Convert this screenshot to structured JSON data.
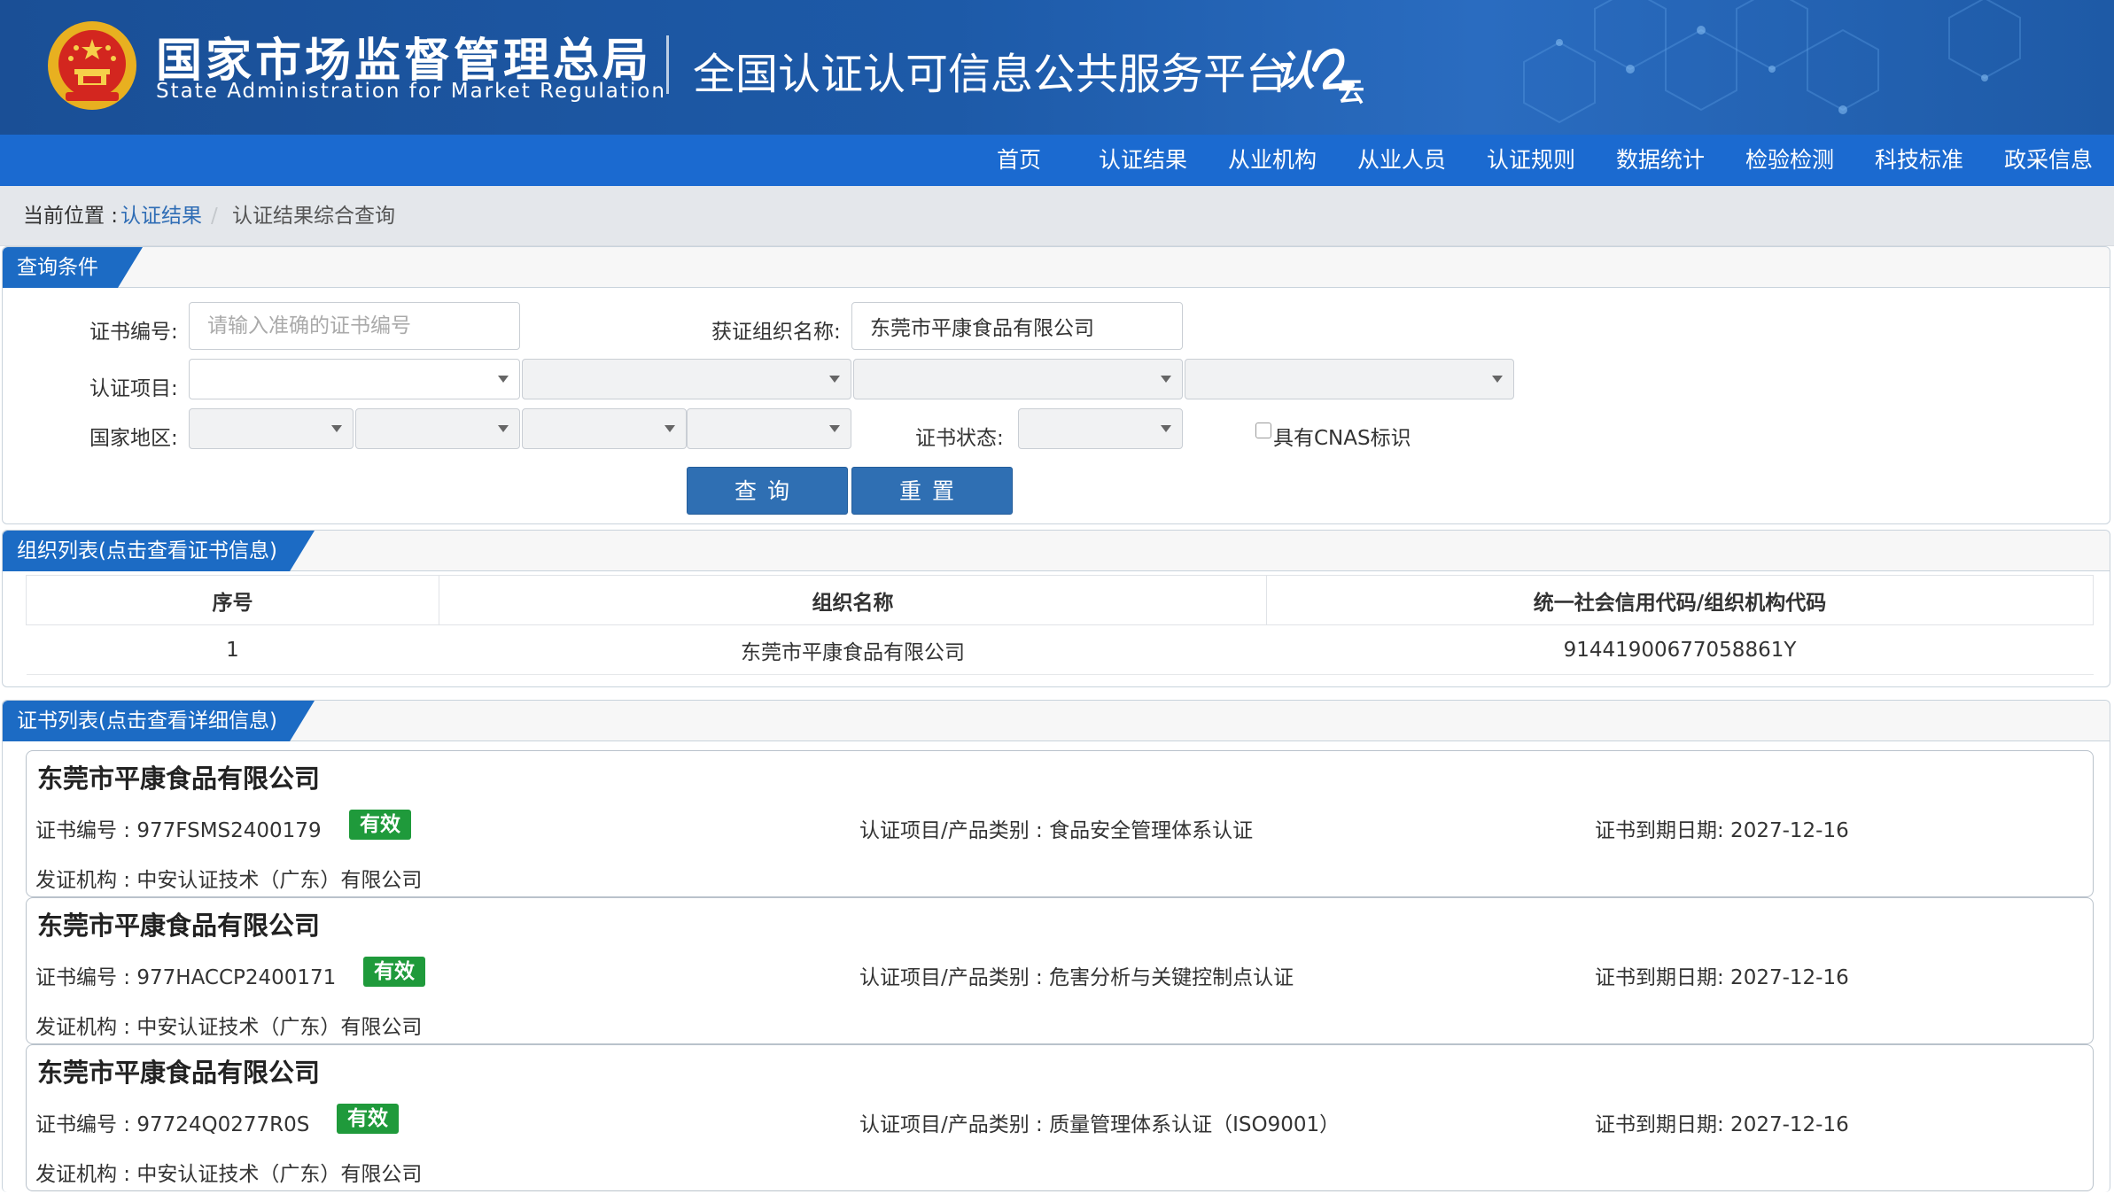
{
  "header": {
    "agency_cn": "国家市场监督管理总局",
    "agency_en": "State Administration  for  Market Regulation",
    "platform_title": "全国认证认可信息公共服务平台",
    "logo_text_1": "认",
    "logo_text_2": "云",
    "colors": {
      "header_bg": "#1d5aa8",
      "nav_bg": "#1b6ad0"
    }
  },
  "nav": {
    "items": [
      "首页",
      "认证结果",
      "从业机构",
      "从业人员",
      "认证规则",
      "数据统计",
      "检验检测",
      "科技标准",
      "政采信息"
    ]
  },
  "breadcrumb": {
    "label": "当前位置 : ",
    "link": "认证结果",
    "separator": "/",
    "current": "认证结果综合查询"
  },
  "query": {
    "title": "查询条件",
    "cert_no_label": "证书编号:",
    "cert_no_placeholder": "请输入准确的证书编号",
    "org_name_label": "获证组织名称:",
    "org_name_value": "东莞市平康食品有限公司",
    "project_label": "认证项目:",
    "region_label": "国家地区:",
    "status_label": "证书状态:",
    "cnas_label": "具有CNAS标识",
    "search_button": "查询",
    "reset_button": "重置"
  },
  "org_list": {
    "title": "组织列表(点击查看证书信息)",
    "columns": [
      "序号",
      "组织名称",
      "统一社会信用代码/组织机构代码"
    ],
    "rows": [
      [
        "1",
        "东莞市平康食品有限公司",
        "91441900677058861Y"
      ]
    ]
  },
  "cert_list": {
    "title": "证书列表(点击查看详细信息)",
    "items": [
      {
        "org": "东莞市平康食品有限公司",
        "cert_no": "证书编号 : 977FSMS2400179",
        "status": "有效",
        "project": "认证项目/产品类别 : 食品安全管理体系认证",
        "expiry": "证书到期日期: 2027-12-16",
        "issuer": "发证机构 : 中安认证技术（广东）有限公司"
      },
      {
        "org": "东莞市平康食品有限公司",
        "cert_no": "证书编号 : 977HACCP2400171",
        "status": "有效",
        "project": "认证项目/产品类别 : 危害分析与关键控制点认证",
        "expiry": "证书到期日期: 2027-12-16",
        "issuer": "发证机构 : 中安认证技术（广东）有限公司"
      },
      {
        "org": "东莞市平康食品有限公司",
        "cert_no": "证书编号 : 97724Q0277R0S",
        "status": "有效",
        "project": "认证项目/产品类别 : 质量管理体系认证（ISO9001）",
        "expiry": "证书到期日期: 2027-12-16",
        "issuer": "发证机构 : 中安认证技术（广东）有限公司"
      }
    ]
  }
}
